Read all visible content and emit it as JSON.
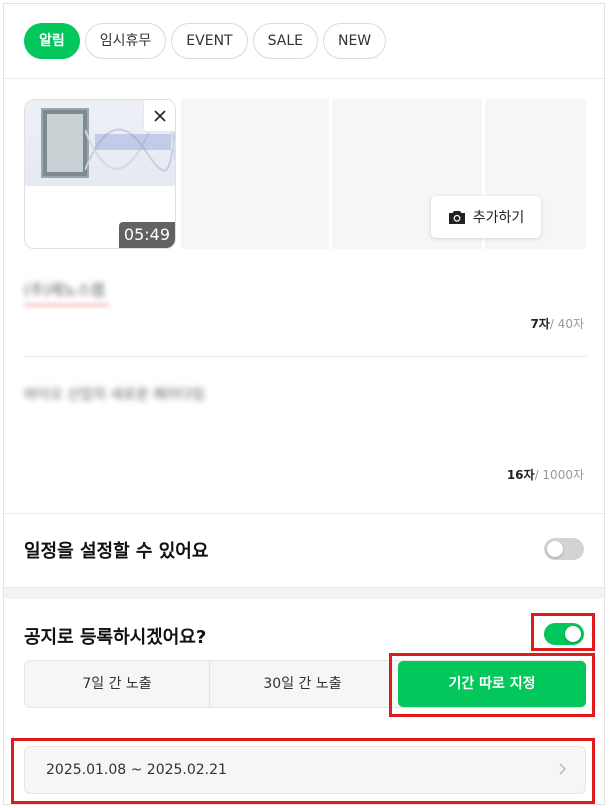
{
  "tabs": [
    {
      "label": "알림",
      "active": true
    },
    {
      "label": "임시휴무",
      "active": false
    },
    {
      "label": "EVENT",
      "active": false
    },
    {
      "label": "SALE",
      "active": false
    },
    {
      "label": "NEW",
      "active": false
    }
  ],
  "media": {
    "thumbnail_icon": "video-thumbnail",
    "duration": "05:49",
    "close_icon": "close-icon",
    "add_label": "추가하기",
    "add_icon": "camera-icon"
  },
  "title_field": {
    "value": "(주)제노스랩",
    "count": "7자",
    "max": "/ 40자"
  },
  "body_field": {
    "value": "바이오 산업의 새로운 패러다임",
    "count": "16자",
    "max": "/ 1000자"
  },
  "schedule": {
    "label": "일정을 설정할 수 있어요",
    "enabled": false
  },
  "notice": {
    "label": "공지로 등록하시겠어요?",
    "enabled": true,
    "options": [
      "7일 간 노출",
      "30일 간 노출",
      "기간 따로 지정"
    ],
    "selected_option": "기간 따로 지정",
    "date_range": "2025.01.08 ~ 2025.02.21"
  },
  "colors": {
    "accent": "#03c75a",
    "highlight": "#e01b1b"
  }
}
